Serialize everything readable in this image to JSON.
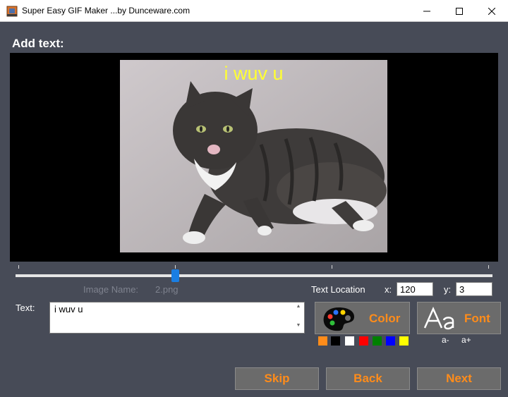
{
  "window": {
    "title": "Super Easy GIF Maker ...by Dunceware.com",
    "minimize_glyph": "—",
    "maximize_glyph": "☐",
    "close_glyph": "✕"
  },
  "section": {
    "label": "Add text:"
  },
  "preview": {
    "overlay_text": "i wuv u",
    "overlay_color": "#ffff33"
  },
  "slider": {
    "position_fraction": 0.33,
    "tick_count": 6
  },
  "image_info": {
    "label": "Image Name:",
    "value": "2.png"
  },
  "text_location": {
    "label": "Text Location",
    "x_label": "x:",
    "x_value": "120",
    "y_label": "y:",
    "y_value": "3"
  },
  "text_input": {
    "label": "Text:",
    "value": "i wuv u"
  },
  "color_button": {
    "label": "Color",
    "icon": "palette-icon"
  },
  "font_button": {
    "label": "Font",
    "icon": "font-icon"
  },
  "swatches": [
    "#ff8c1a",
    "#000000",
    "#ffffff",
    "#ff0000",
    "#008000",
    "#0000ff",
    "#ffff00"
  ],
  "font_size": {
    "decrease": "a-",
    "increase": "a+"
  },
  "nav": {
    "skip": "Skip",
    "back": "Back",
    "next": "Next"
  },
  "accent_color": "#ff8c1a"
}
